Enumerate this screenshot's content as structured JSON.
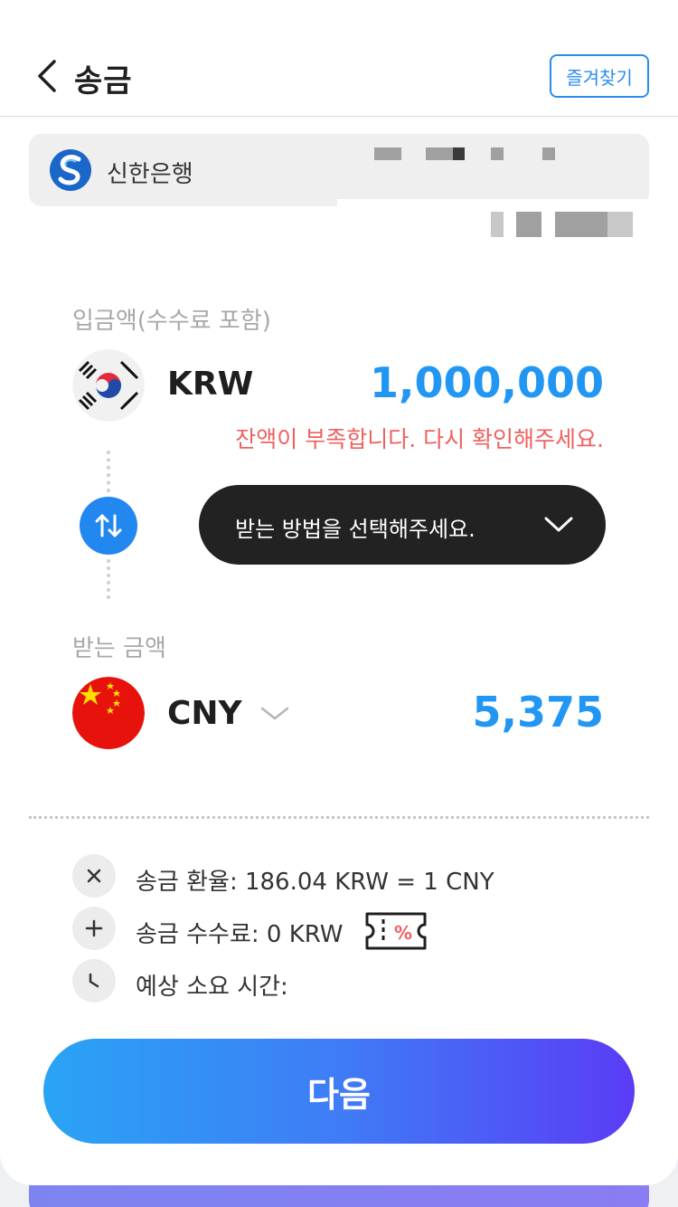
{
  "header": {
    "title": "송금",
    "favorites_label": "즐겨찾기"
  },
  "account": {
    "bank_name": "신한은행",
    "bank_logo_icon": "shinhan-logo-icon"
  },
  "send": {
    "label": "입금액(수수료 포함)",
    "currency": "KRW",
    "amount": "1,000,000",
    "error": "잔액이 부족합니다. 다시 확인해주세요.",
    "flag_icon": "korea-flag-icon"
  },
  "method": {
    "placeholder": "받는 방법을 선택해주세요."
  },
  "receive": {
    "label": "받는 금액",
    "currency": "CNY",
    "amount": "5,375",
    "flag_icon": "china-flag-icon"
  },
  "info": {
    "rate": "송금 환율: 186.04 KRW = 1 CNY",
    "fee": "송금 수수료: 0 KRW",
    "time": "예상 소요 시간:"
  },
  "next_label": "다음",
  "colors": {
    "accent": "#2196f3",
    "error": "#f06060",
    "dark_button": "#222222",
    "gradient_start": "#29a4f5",
    "gradient_end": "#5a3cf6"
  }
}
